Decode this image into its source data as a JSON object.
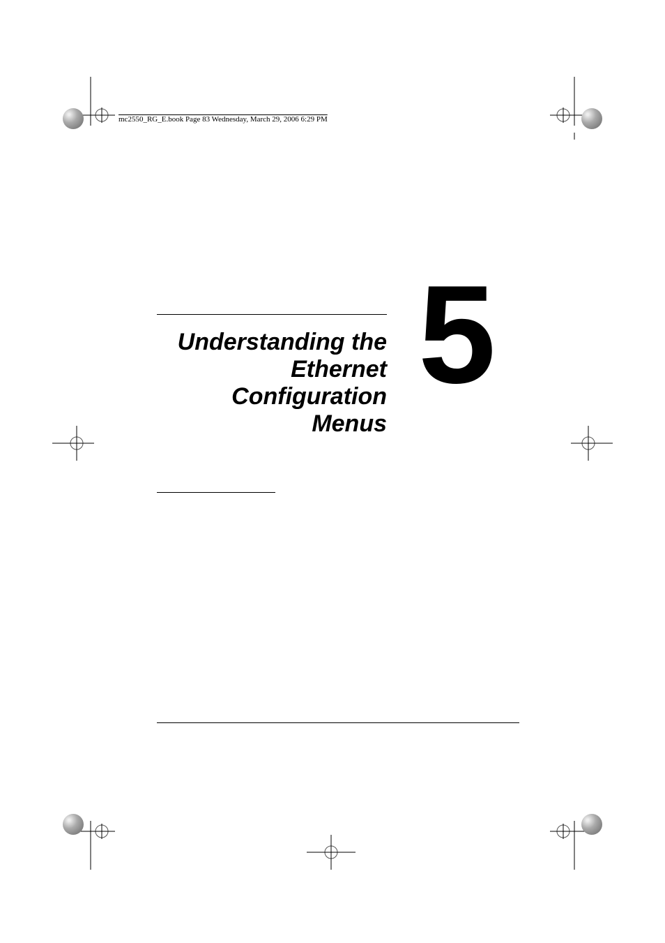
{
  "header": {
    "text": "mc2550_RG_E.book  Page 83  Wednesday, March 29, 2006  6:29 PM"
  },
  "chapter": {
    "number": "5",
    "title": "Understanding the Ethernet Configuration Menus"
  }
}
